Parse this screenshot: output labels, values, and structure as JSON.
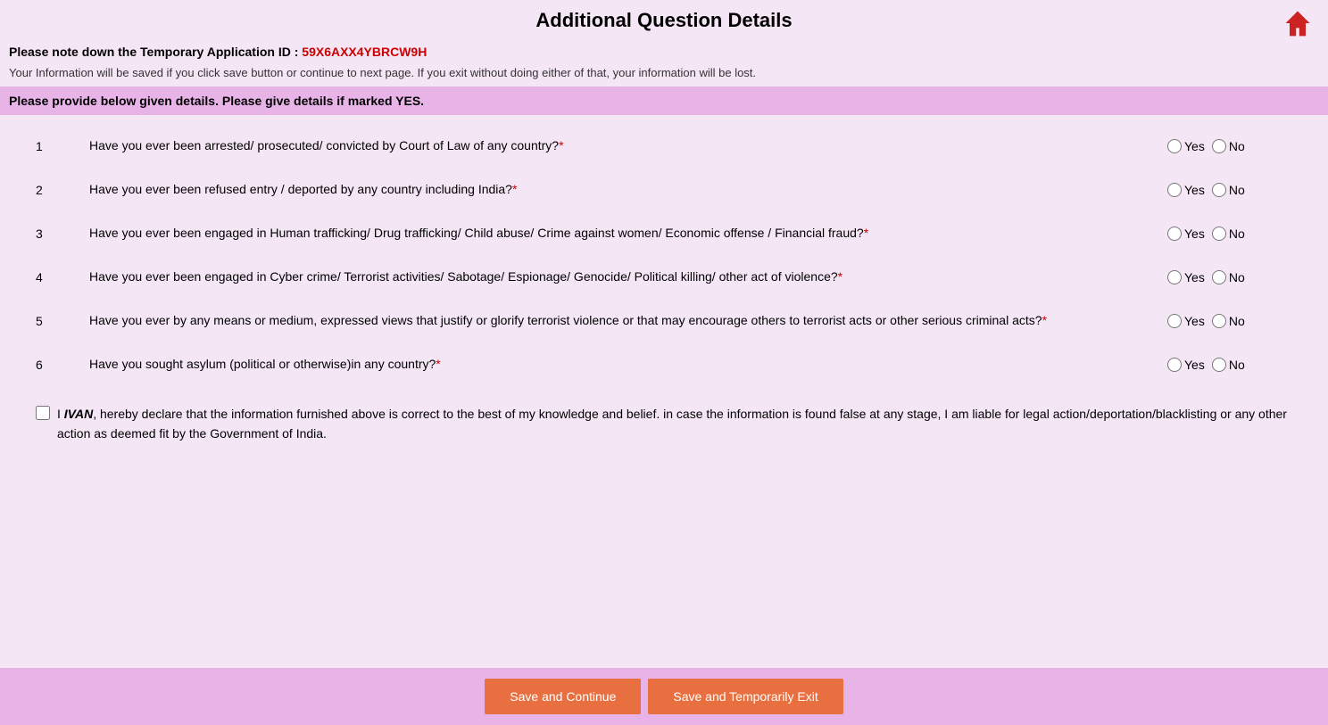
{
  "page": {
    "title": "Additional Question Details",
    "tempId": {
      "label": "Please note down the Temporary Application ID :",
      "value": "59X6AXX4YBRCW9H"
    },
    "infoText": "Your Information will be saved if you click save button or continue to next page. If you exit without doing either of that, your information will be lost.",
    "noticeBar": "Please provide below given details. Please give details if marked YES.",
    "declarationText": "I IVAN, hereby declare that the information furnished above is correct to the best of my knowledge and belief. in case the information is found false at any stage, I am liable for legal action/deportation/blacklisting or any other action as deemed fit by the Government of India.",
    "declarationName": "IVAN",
    "declarationPrefix": "I",
    "declarationSuffix": ", hereby declare that the information furnished above is correct to the best of my knowledge and belief. in case the information is found false at any stage, I am liable for legal action/deportation/blacklisting or any other action as deemed fit by the Government of India.",
    "buttons": {
      "saveAndContinue": "Save and Continue",
      "saveAndExit": "Save and Temporarily Exit"
    }
  },
  "questions": [
    {
      "id": 1,
      "number": "1",
      "text": "Have you ever been arrested/ prosecuted/ convicted by Court of Law of any country?",
      "required": true
    },
    {
      "id": 2,
      "number": "2",
      "text": "Have you ever been refused entry / deported by any country including India?",
      "required": true
    },
    {
      "id": 3,
      "number": "3",
      "text": "Have you ever been engaged in Human trafficking/ Drug trafficking/ Child abuse/ Crime against women/ Economic offense / Financial fraud?",
      "required": true
    },
    {
      "id": 4,
      "number": "4",
      "text": "Have you ever been engaged in Cyber crime/ Terrorist activities/ Sabotage/ Espionage/ Genocide/ Political killing/ other act of violence?",
      "required": true
    },
    {
      "id": 5,
      "number": "5",
      "text": "Have you ever by any means or medium, expressed views that justify or glorify terrorist violence or that may encourage others to terrorist acts or other serious criminal acts?",
      "required": true
    },
    {
      "id": 6,
      "number": "6",
      "text": "Have you sought asylum (political or otherwise)in any country?",
      "required": true
    }
  ],
  "radioOptions": {
    "yes": "Yes",
    "no": "No"
  }
}
